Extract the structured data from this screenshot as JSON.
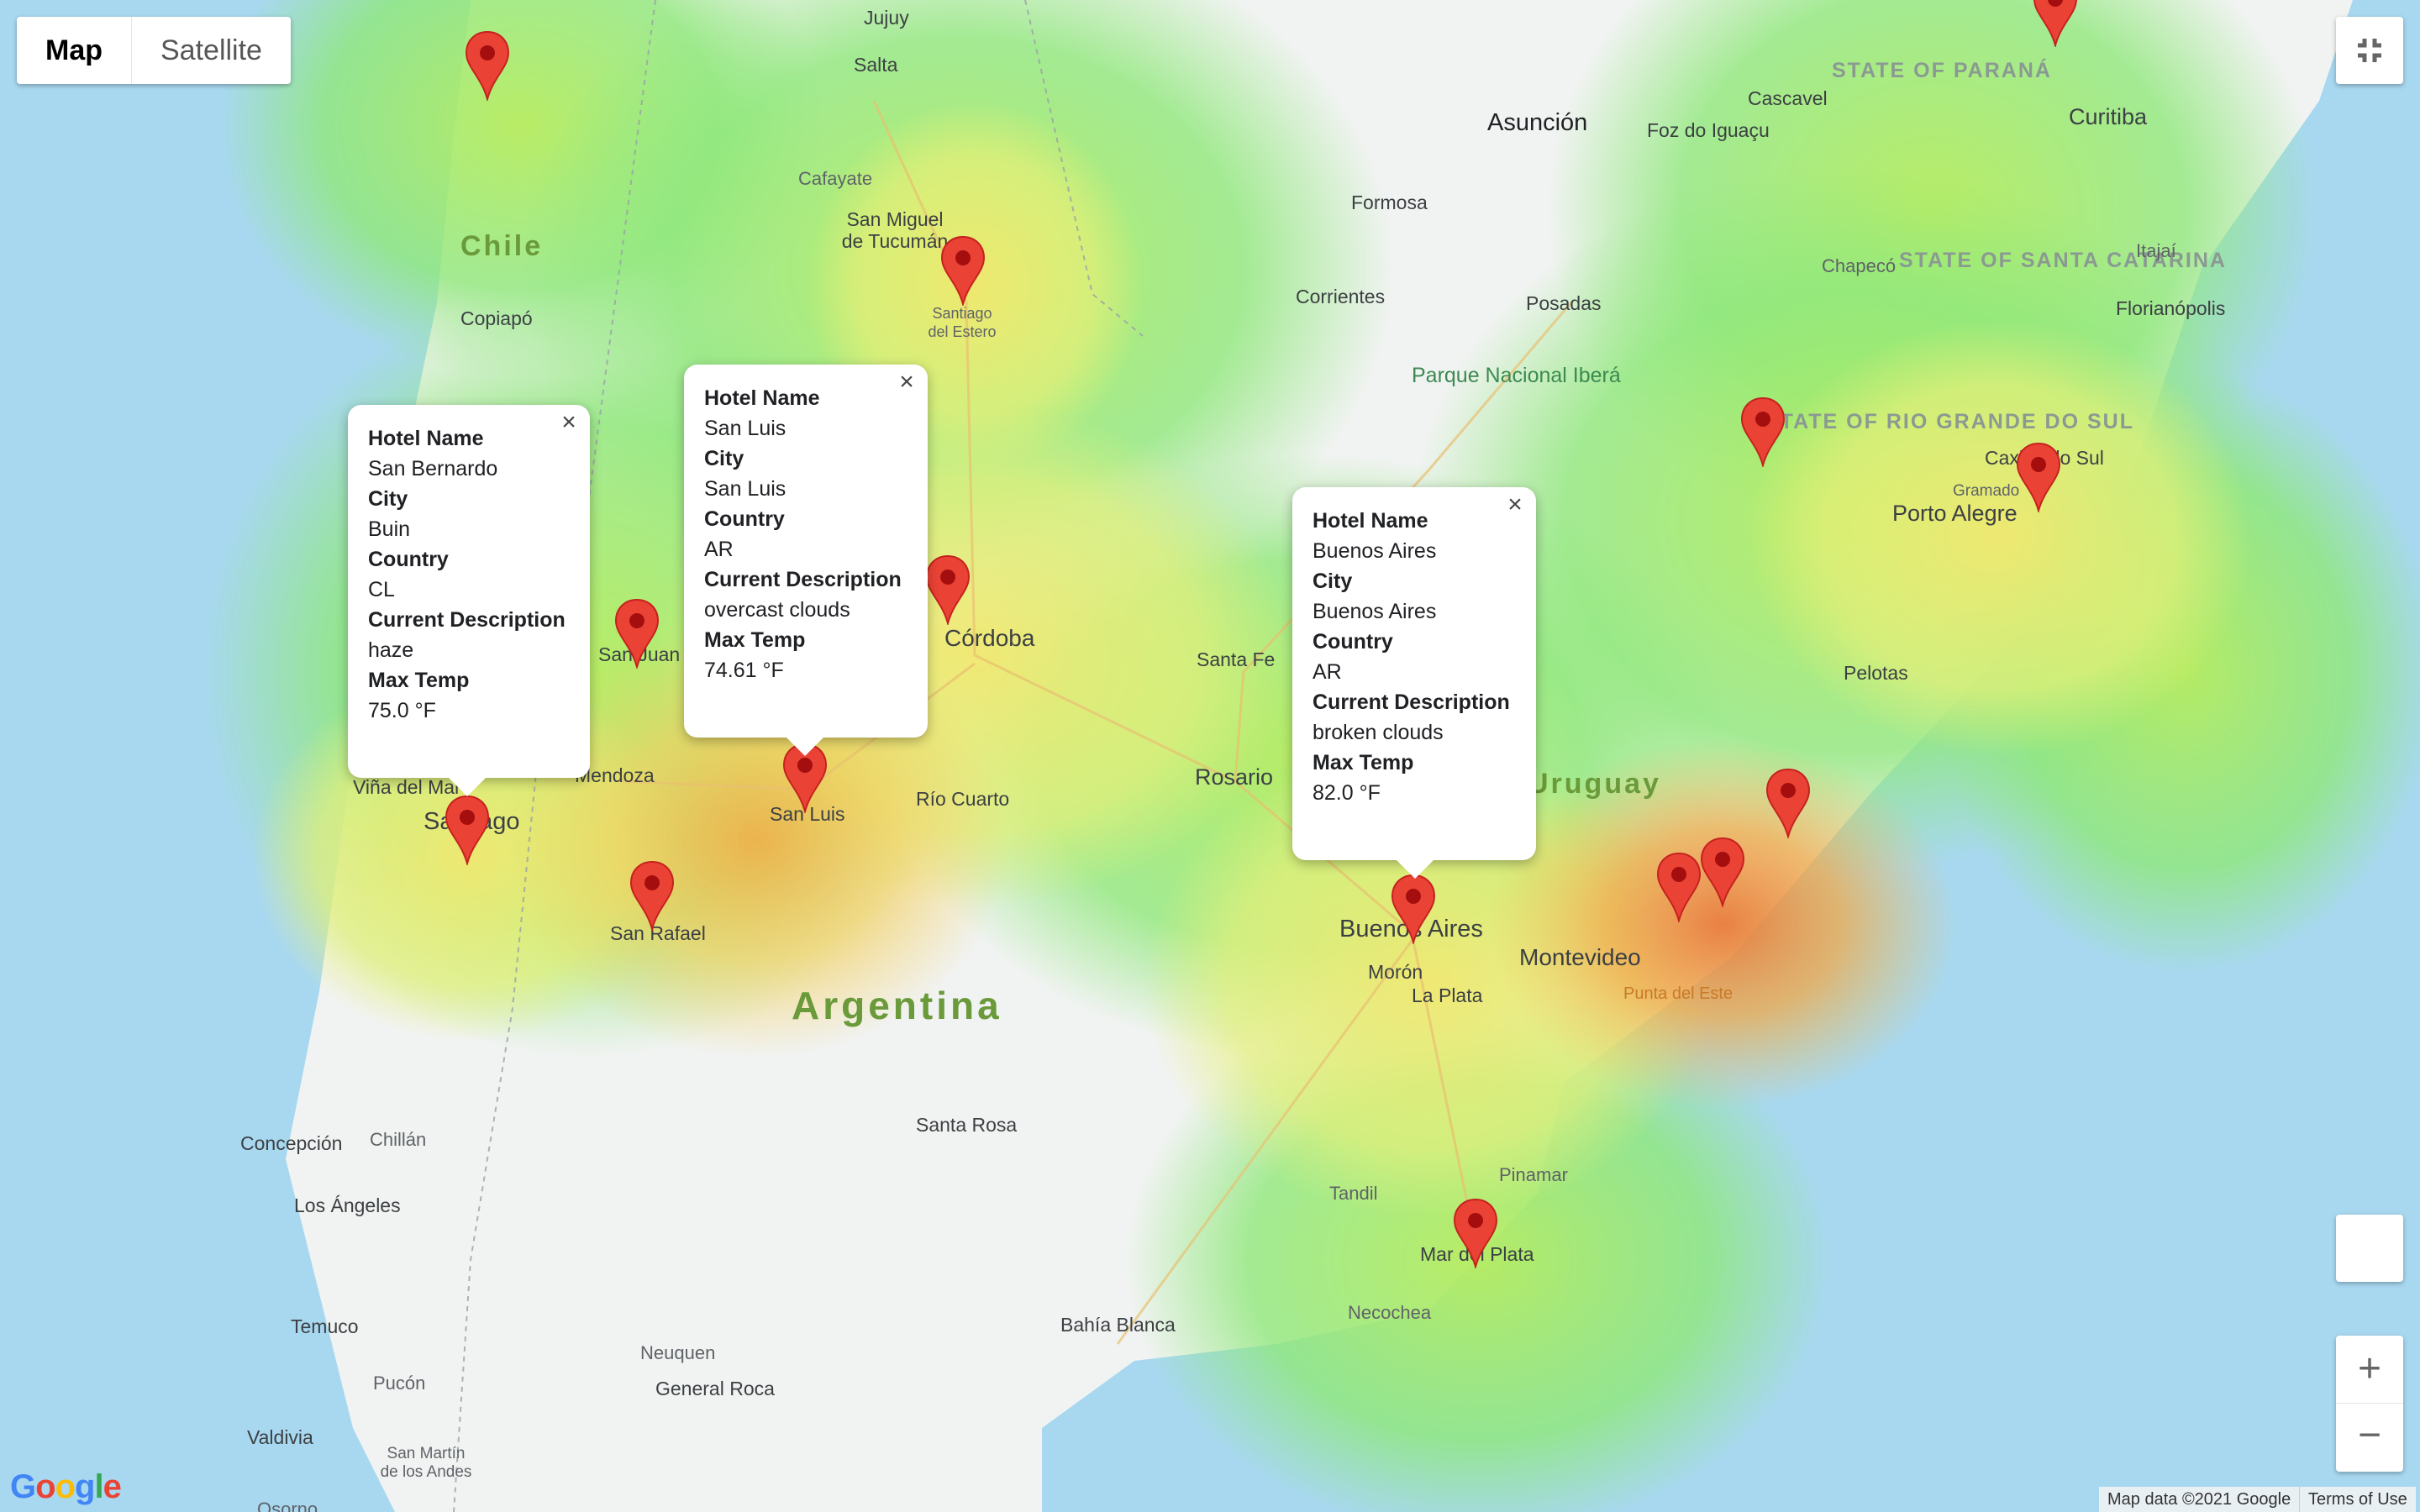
{
  "map_type_control": {
    "map": "Map",
    "satellite": "Satellite"
  },
  "labels": {
    "chile": "Chile",
    "argentina": "Argentina",
    "uruguay": "Uruguay",
    "state_parana": "STATE OF PARANÁ",
    "state_santa_catarina": "STATE OF SANTA CATARINA",
    "state_rio_grande": "STATE OF RIO GRANDE DO SUL",
    "parque": "Parque Nacional Iberá",
    "cities": [
      "Jujuy",
      "Salta",
      "Cafayate",
      "San Miguel de Tucumán",
      "Copiapó",
      "Formosa",
      "Corrientes",
      "Posadas",
      "Foz do Iguaçu",
      "Cascavel",
      "Curitiba",
      "Chapecó",
      "Itajaí",
      "Florianópolis",
      "Caxias do Sul",
      "Gramado",
      "Porto Alegre",
      "Pelotas",
      "Santa Fe",
      "Rosario",
      "Mendoza",
      "Viña del Mar",
      "Santiago",
      "San Juan",
      "Córdoba",
      "Río Cuarto",
      "San Luis",
      "San Rafael",
      "Buenos Aires",
      "Morón",
      "La Plata",
      "Montevideo",
      "Punta del Este",
      "Santa Rosa",
      "Concepción",
      "Chillán",
      "Los Ángeles",
      "Tandil",
      "Pinamar",
      "Mar del Plata",
      "Necochea",
      "Bahía Blanca",
      "Temuco",
      "Neuquen",
      "General Roca",
      "Pucón",
      "Valdivia",
      "San Martín de los Andes",
      "Osorno",
      "Santiago del Estero"
    ],
    "asuncion": "Asunción"
  },
  "popups": [
    {
      "name": "popup-san-bernardo",
      "hotel_label": "Hotel Name",
      "hotel": "San Bernardo",
      "city_label": "City",
      "city": "Buin",
      "country_label": "Country",
      "country": "CL",
      "desc_label": "Current Description",
      "desc": "haze",
      "temp_label": "Max Temp",
      "temp": "75.0 °F"
    },
    {
      "name": "popup-san-luis",
      "hotel_label": "Hotel Name",
      "hotel": "San Luis",
      "city_label": "City",
      "city": "San Luis",
      "country_label": "Country",
      "country": "AR",
      "desc_label": "Current Description",
      "desc": "overcast clouds",
      "temp_label": "Max Temp",
      "temp": "74.61 °F"
    },
    {
      "name": "popup-buenos-aires",
      "hotel_label": "Hotel Name",
      "hotel": "Buenos Aires",
      "city_label": "City",
      "city": "Buenos Aires",
      "country_label": "Country",
      "country": "AR",
      "desc_label": "Current Description",
      "desc": "broken clouds",
      "temp_label": "Max Temp",
      "temp": "82.0 °F"
    }
  ],
  "popup_close": "×",
  "zoom": {
    "in": "+",
    "out": "−"
  },
  "attribution": {
    "data": "Map data ©2021 Google",
    "terms": "Terms of Use"
  },
  "logo": "Google",
  "colors": {
    "marker": "#ea4335",
    "marker_dot": "#a50e0e",
    "water": "#a8d8f0"
  }
}
